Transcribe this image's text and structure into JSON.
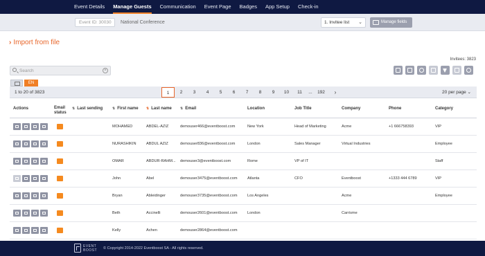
{
  "nav": {
    "tabs": [
      "Event Details",
      "Manage Guests",
      "Communication",
      "Event Page",
      "Badges",
      "App Setup",
      "Check-in"
    ],
    "active": "Manage Guests"
  },
  "event_bar": {
    "event_id": "Event ID: 30030",
    "event_name": "National Conference",
    "invitee_list": "1. Invitee list",
    "manage_fields": "Manage fields"
  },
  "import_label": "Import from file",
  "invitees_count": "Invitees: 3823",
  "search": {
    "placeholder": "Search"
  },
  "language": {
    "active": "EN"
  },
  "pagination": {
    "range": "1 to 20 of 3823",
    "pages": [
      "1",
      "2",
      "3",
      "4",
      "5",
      "6",
      "7",
      "8",
      "9",
      "10",
      "11",
      "...",
      "192"
    ],
    "current": "1",
    "next": "›",
    "per_page": "20 per page"
  },
  "table": {
    "columns": {
      "actions": "Actions",
      "email_status_1": "Email",
      "email_status_2": "status",
      "last_sending": "Last sending",
      "first_name": "First name",
      "last_name": "Last name",
      "email": "Email",
      "location": "Location",
      "job_title": "Job Title",
      "company": "Company",
      "phone": "Phone",
      "category": "Category"
    },
    "rows": [
      {
        "first": "MOHAMED",
        "last": "ABDEL-AZIZ",
        "email": "demouser466@eventboost.com",
        "location": "New York",
        "job": "Head of Marketing",
        "company": "Acme",
        "phone": "+1 666758393",
        "category": "VIP"
      },
      {
        "first": "NURASHIKIN",
        "last": "ABDUL AZIZ",
        "email": "demouser836@eventboost.com",
        "location": "London",
        "job": "Sales Manager",
        "company": "Virtual Industries",
        "phone": "",
        "category": "Employee"
      },
      {
        "first": "OMAR",
        "last": "ABDUR-RAHM...",
        "email": "demouser3@eventboost.com",
        "location": "Rome",
        "job": "VP of IT",
        "company": "",
        "phone": "",
        "category": "Staff"
      },
      {
        "first": "John",
        "last": "Abel",
        "email": "demouser3475@eventboost.com",
        "location": "Atlanta",
        "job": "CFO",
        "company": "Eventboost",
        "phone": "+1333 444 6789",
        "category": "VIP"
      },
      {
        "first": "Bryan",
        "last": "Ableidinger",
        "email": "demouser3735@eventboost.com",
        "location": "Los Angeles",
        "job": "",
        "company": "Acme",
        "phone": "",
        "category": "Employee"
      },
      {
        "first": "Beth",
        "last": "Accinelli",
        "email": "demouser2601@eventboost.com",
        "location": "London",
        "job": "",
        "company": "Carrisme",
        "phone": "",
        "category": ""
      },
      {
        "first": "Kelly",
        "last": "Achen",
        "email": "demouser2864@eventboost.com",
        "location": "",
        "job": "",
        "company": "",
        "phone": "",
        "category": ""
      }
    ]
  },
  "footer": {
    "logo_line1": "EVENT",
    "logo_line2": "BOOST",
    "copyright": "© Copyright 2014-2022 Eventboost SA - All rights reserved."
  },
  "colors": {
    "nav_bg": "#0f1942",
    "accent": "#f07f26",
    "status": "#f58a1f",
    "button": "#9b9fae"
  }
}
